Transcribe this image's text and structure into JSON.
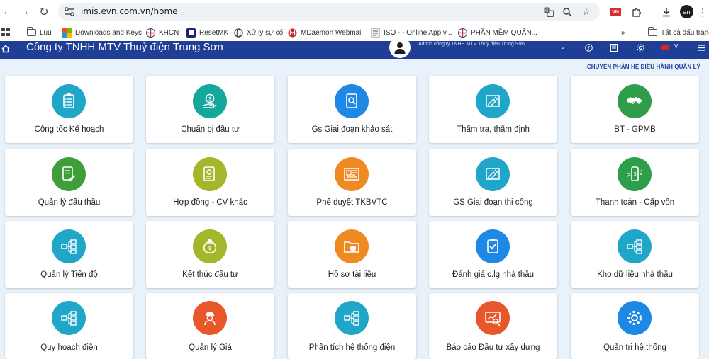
{
  "browser": {
    "url": "imis.evn.com.vn/home",
    "profile_initials": "an",
    "extension_label": "VN"
  },
  "bookmarks": {
    "items": [
      {
        "label": "Luu",
        "icon": "folder-icon"
      },
      {
        "label": "Downloads and Keys",
        "icon": "windows-logo-icon"
      },
      {
        "label": "KHCN",
        "icon": "evn-logo-icon"
      },
      {
        "label": "ResetMK",
        "icon": "reset-icon"
      },
      {
        "label": "Xử lý sự cố",
        "icon": "globe-icon"
      },
      {
        "label": "MDaemon Webmail",
        "icon": "mdaemon-icon"
      },
      {
        "label": "ISO - - Online App v...",
        "icon": "iso-icon"
      },
      {
        "label": "PHẦN MỀM QUẢN...",
        "icon": "evn-logo-icon"
      }
    ],
    "all_bookmarks_label": "Tất cả dấu trang"
  },
  "app": {
    "company_name": "Công ty TNHH MTV Thuỷ điện Trung Sơn",
    "user_line": "Admin công ty TNHH MTV Thuỷ điện Trung Sơn",
    "language": "VI",
    "subheader": "CHUYÊN PHÂN HỆ ĐIỀU HÀNH QUẢN LÝ"
  },
  "modules": [
    {
      "label": "Công tốc Kế hoạch",
      "color": "#1fa6c9",
      "icon": "clipboard-checklist-icon"
    },
    {
      "label": "Chuẩn bị đầu tư",
      "color": "#14a89a",
      "icon": "money-hand-icon"
    },
    {
      "label": "Gs Giai đoạn khảo sát",
      "color": "#1e88e5",
      "icon": "magnifier-document-icon"
    },
    {
      "label": "Thẩm tra, thẩm định",
      "color": "#1fa6c9",
      "icon": "blueprint-pencil-icon"
    },
    {
      "label": "BT - GPMB",
      "color": "#2e9e4a",
      "icon": "handshake-icon"
    },
    {
      "label": "Quản lý đấu thầu",
      "color": "#3f9d3a",
      "icon": "document-pen-icon"
    },
    {
      "label": "Hợp đồng - CV khác",
      "color": "#a4b62a",
      "icon": "contract-icon"
    },
    {
      "label": "Phê duyệt TKBVTC",
      "color": "#ef8a23",
      "icon": "blueprint-icon"
    },
    {
      "label": "GS Giai đoạn thi công",
      "color": "#1fa6c9",
      "icon": "blueprint-pencil-icon"
    },
    {
      "label": "Thanh toán - Cấp vốn",
      "color": "#2e9e4a",
      "icon": "mobile-payment-icon"
    },
    {
      "label": "Quản lý Tiến độ",
      "color": "#1fa6c9",
      "icon": "flowchart-icon"
    },
    {
      "label": "Kết thúc đầu tư",
      "color": "#a4b62a",
      "icon": "money-bag-icon"
    },
    {
      "label": "Hồ sơ tài liệu",
      "color": "#ef8a23",
      "icon": "folder-shield-icon"
    },
    {
      "label": "Đánh giá c.lg nhà thầu",
      "color": "#1e88e5",
      "icon": "clipboard-check-icon"
    },
    {
      "label": "Kho dữ liệu nhà thầu",
      "color": "#1fa6c9",
      "icon": "flowchart-icon"
    },
    {
      "label": "Quy hoạch điện",
      "color": "#1fa6c9",
      "icon": "flowchart-icon"
    },
    {
      "label": "Quản lý Giá",
      "color": "#e8562a",
      "icon": "engineer-money-icon"
    },
    {
      "label": "Phân tích hệ thống điện",
      "color": "#1fa6c9",
      "icon": "flowchart-icon"
    },
    {
      "label": "Báo cáo Đầu tư xây dựng",
      "color": "#e8562a",
      "icon": "report-chart-icon"
    },
    {
      "label": "Quản trị hệ thống",
      "color": "#1e88e5",
      "icon": "gear-icon"
    }
  ]
}
